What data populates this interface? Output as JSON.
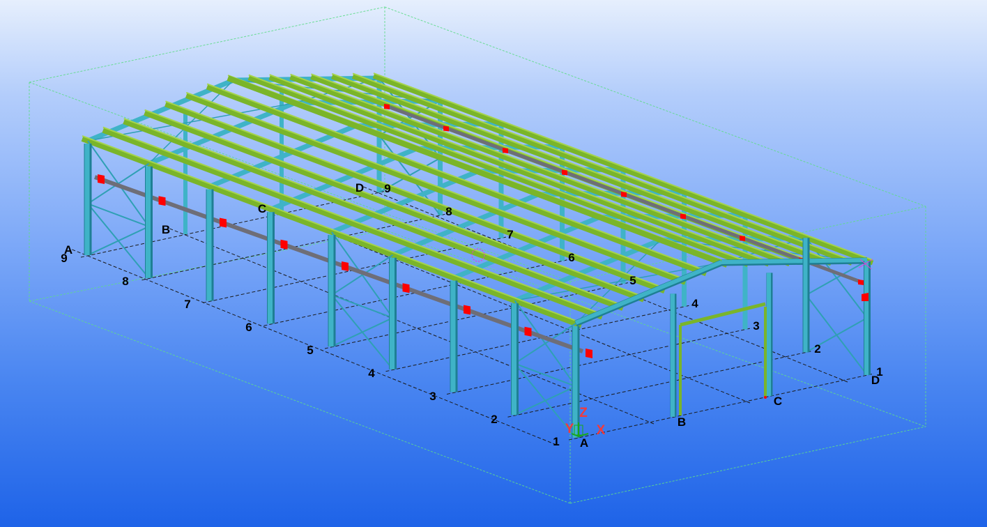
{
  "model_view": {
    "colors": {
      "column": "#3fb3c7",
      "column_edge": "#1e7f94",
      "rafter": "#3fb3c7",
      "purlin": "#7ab52a",
      "purlin_top": "#a5d44a",
      "brace": "#2fa0b4",
      "strut": "#6e6e78",
      "bracket": "#ff0000",
      "grid_line": "#1a1a1a",
      "bounding_box": "#5fdc8a",
      "axis_label": "#f23a3a"
    },
    "grid_labels": {
      "long_side": [
        "1",
        "2",
        "3",
        "4",
        "5",
        "6",
        "7",
        "8",
        "9"
      ],
      "long_side_far": [
        "4",
        "5",
        "6",
        "7",
        "8",
        "9"
      ],
      "front_corner_1": "1",
      "front_corner_a": "A",
      "end_wall": [
        "B",
        "C",
        "D"
      ],
      "right_end_numbers": [
        "1",
        "2",
        "3"
      ],
      "left_end": [
        "A",
        "9",
        "B",
        "C",
        "D"
      ]
    },
    "axis_labels": {
      "x": "X",
      "y": "Y",
      "z": "Z"
    }
  }
}
